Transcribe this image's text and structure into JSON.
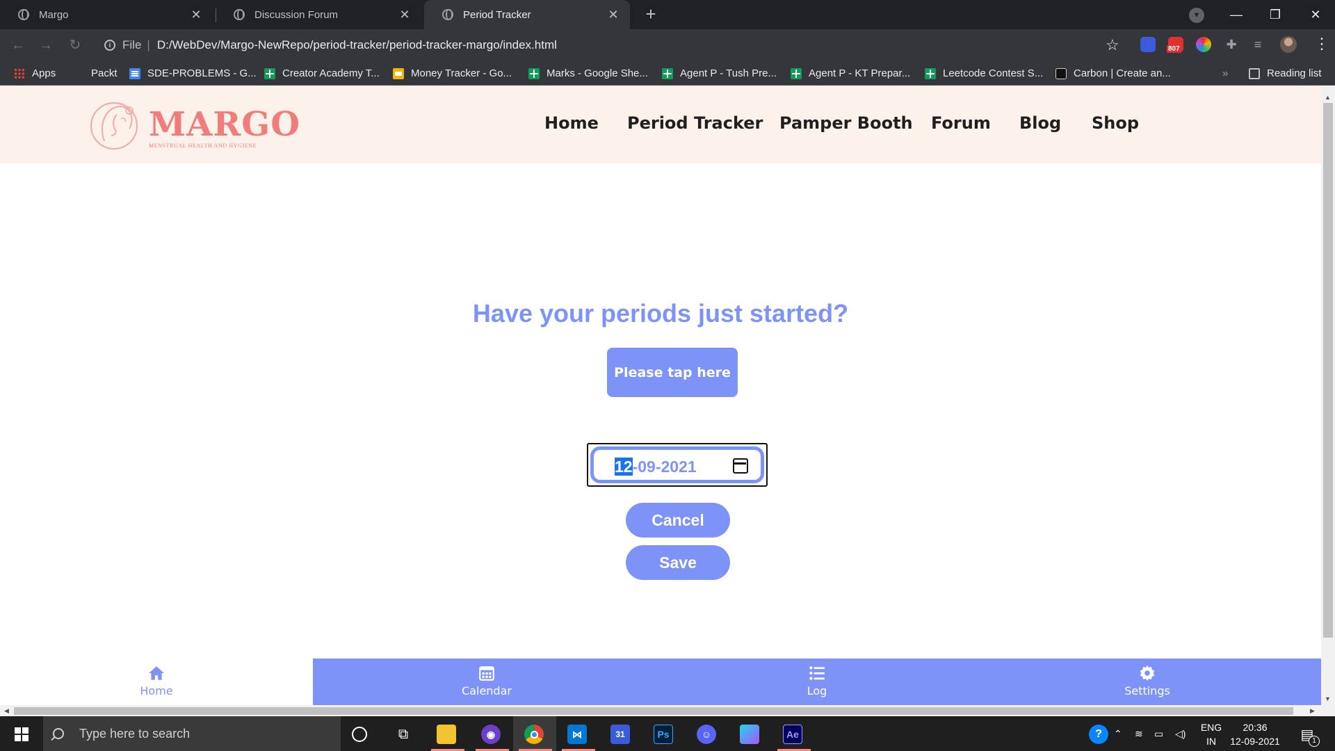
{
  "browser": {
    "tabs": [
      {
        "title": "Margo",
        "active": false
      },
      {
        "title": "Discussion Forum",
        "active": false
      },
      {
        "title": "Period Tracker",
        "active": true
      }
    ],
    "address": {
      "scheme": "File",
      "url": "D:/WebDev/Margo-NewRepo/period-tracker/period-tracker-margo/index.html"
    },
    "extension_badge": "807",
    "bookmarks": [
      {
        "label": "Apps",
        "icon": "apps-icon"
      },
      {
        "label": "Packt",
        "icon": "none"
      },
      {
        "label": "SDE-PROBLEMS - G...",
        "icon": "google-docs-icon"
      },
      {
        "label": "Creator Academy T...",
        "icon": "google-sheets-icon"
      },
      {
        "label": "Money Tracker - Go...",
        "icon": "google-slides-icon"
      },
      {
        "label": "Marks - Google She...",
        "icon": "google-sheets-icon"
      },
      {
        "label": "Agent P - Tush Pre...",
        "icon": "google-sheets-icon"
      },
      {
        "label": "Agent P - KT Prepar...",
        "icon": "google-sheets-icon"
      },
      {
        "label": "Leetcode Contest S...",
        "icon": "google-sheets-icon"
      },
      {
        "label": "Carbon | Create an...",
        "icon": "carbon-icon"
      }
    ],
    "bookmarks_overflow": "»",
    "reading_list": "Reading list"
  },
  "site": {
    "logo": {
      "name": "MARGO",
      "tagline": "MENSTRUAL HEALTH AND HYGIENE"
    },
    "nav": [
      "Home",
      "Period Tracker",
      "Pamper Booth",
      "Forum",
      "Blog",
      "Shop"
    ],
    "headline": "Have your periods just started?",
    "tap_button": "Please tap here",
    "date_input": {
      "day": "12",
      "rest": "-09-2021"
    },
    "cancel_button": "Cancel",
    "save_button": "Save",
    "bottom_tabs": [
      {
        "label": "Home",
        "icon": "home-icon",
        "active": true
      },
      {
        "label": "Calendar",
        "icon": "calendar-icon",
        "active": false
      },
      {
        "label": "Log",
        "icon": "list-icon",
        "active": false
      },
      {
        "label": "Settings",
        "icon": "gear-icon",
        "active": false
      }
    ],
    "colors": {
      "accent": "#7e93f7",
      "header_bg": "#fdf1ec",
      "logo": "#f07d7a"
    }
  },
  "taskbar": {
    "search_placeholder": "Type here to search",
    "language": {
      "line1": "ENG",
      "line2": "IN"
    },
    "clock": {
      "time": "20:36",
      "date": "12-09-2021"
    },
    "notification_count": "1",
    "calendar_app_day": "31"
  }
}
